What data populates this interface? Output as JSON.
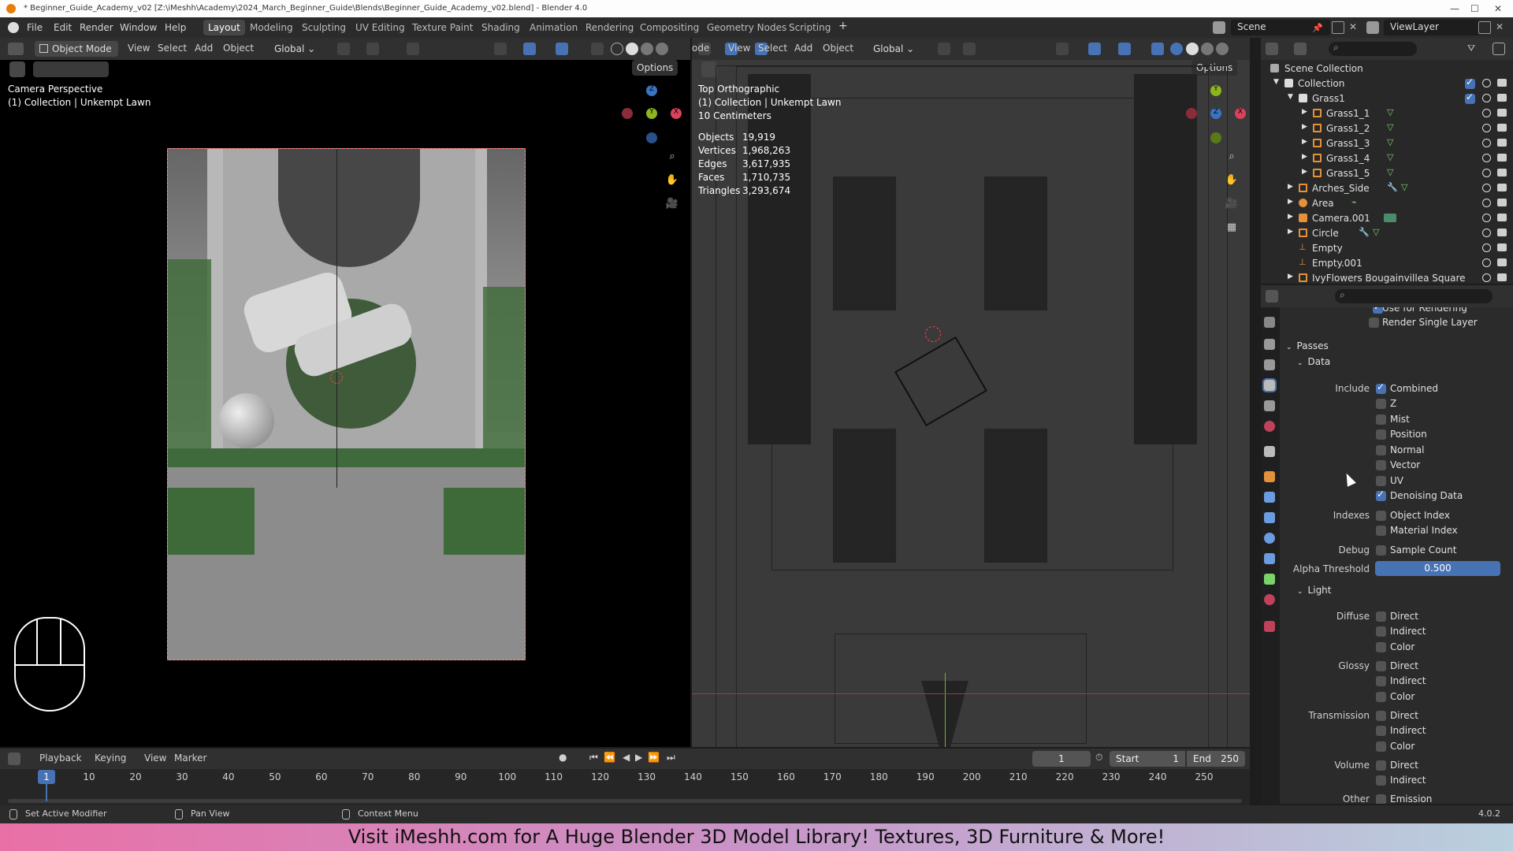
{
  "window": {
    "title": "* Beginner_Guide_Academy_v02 [Z:\\iMeshh\\Academy\\2024_March_Beginner_Guide\\Blends\\Beginner_Guide_Academy_v02.blend] - Blender 4.0"
  },
  "menu": [
    "File",
    "Edit",
    "Render",
    "Window",
    "Help"
  ],
  "workspaces": [
    "Layout",
    "Modeling",
    "Sculpting",
    "UV Editing",
    "Texture Paint",
    "Shading",
    "Animation",
    "Rendering",
    "Compositing",
    "Geometry Nodes",
    "Scripting"
  ],
  "scene": {
    "name": "Scene",
    "view_layer": "ViewLayer"
  },
  "left_header": {
    "mode": "Object Mode",
    "view": "View",
    "select": "Select",
    "add": "Add",
    "object": "Object",
    "orientation": "Global",
    "options": "Options"
  },
  "right_header": {
    "mode": "ode",
    "view": "View",
    "select": "Select",
    "add": "Add",
    "object": "Object",
    "orientation": "Global",
    "options": "Options"
  },
  "left_viewport": {
    "line1": "Camera Perspective",
    "line2": "(1) Collection | Unkempt Lawn"
  },
  "right_viewport": {
    "line1": "Top Orthographic",
    "line2": "(1) Collection | Unkempt Lawn",
    "line3": "10 Centimeters",
    "stats": [
      {
        "k": "Objects",
        "v": "19,919"
      },
      {
        "k": "Vertices",
        "v": "1,968,263"
      },
      {
        "k": "Edges",
        "v": "3,617,935"
      },
      {
        "k": "Faces",
        "v": "1,710,735"
      },
      {
        "k": "Triangles",
        "v": "3,293,674"
      }
    ]
  },
  "gizmo": {
    "x": "X",
    "y": "Y",
    "z": "Z"
  },
  "outliner": {
    "root": "Scene Collection",
    "items": [
      "Collection",
      "Grass1",
      "Grass1_1",
      "Grass1_2",
      "Grass1_3",
      "Grass1_4",
      "Grass1_5",
      "Arches_Side",
      "Area",
      "Camera.001",
      "Circle",
      "Empty",
      "Empty.001",
      "IvyFlowers Bougainvillea Square"
    ]
  },
  "props": {
    "use_for_rendering": "Use for Rendering",
    "render_single_layer": "Render Single Layer",
    "passes": "Passes",
    "data": "Data",
    "include": "Include",
    "data_passes": [
      "Combined",
      "Z",
      "Mist",
      "Position",
      "Normal",
      "Vector",
      "UV",
      "Denoising Data"
    ],
    "indexes": "Indexes",
    "index_passes": [
      "Object Index",
      "Material Index"
    ],
    "debug": "Debug",
    "sample_count": "Sample Count",
    "alpha_threshold": "Alpha Threshold",
    "alpha_value": "0.500",
    "light": "Light",
    "diffuse": "Diffuse",
    "glossy": "Glossy",
    "transmission": "Transmission",
    "volume": "Volume",
    "other": "Other",
    "direct": "Direct",
    "indirect": "Indirect",
    "color": "Color",
    "emission": "Emission"
  },
  "timeline": {
    "playback": "Playback",
    "keying": "Keying",
    "view": "View",
    "marker": "Marker",
    "frame": "1",
    "start_label": "Start",
    "start": "1",
    "end_label": "End",
    "end": "250",
    "ticks": [
      "1",
      "10",
      "20",
      "30",
      "40",
      "50",
      "60",
      "70",
      "80",
      "90",
      "100",
      "110",
      "120",
      "130",
      "140",
      "150",
      "160",
      "170",
      "180",
      "190",
      "200",
      "210",
      "220",
      "230",
      "240",
      "250"
    ]
  },
  "status": {
    "a": "Set Active Modifier",
    "b": "Pan View",
    "c": "Context Menu",
    "version": "4.0.2"
  },
  "banner": "Visit iMeshh.com for A Huge Blender 3D Model Library! Textures, 3D Furniture & More!"
}
